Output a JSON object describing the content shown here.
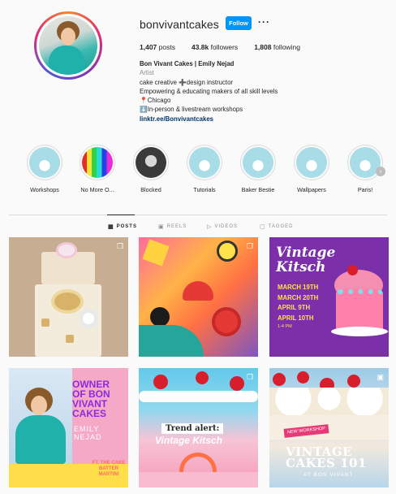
{
  "profile": {
    "username": "bonvivantcakes",
    "follow_label": "Follow",
    "more_label": "···",
    "stats": {
      "posts_count": "1,407",
      "posts_label": "posts",
      "followers_count": "43.8k",
      "followers_label": "followers",
      "following_count": "1,808",
      "following_label": "following"
    },
    "bio": {
      "name": "Bon Vivant Cakes | Emily Nejad",
      "category": "Artist",
      "line1": "cake creative ➕design instructor",
      "line2": "Empowering & educating makers of all skill levels",
      "line3": "📍Chicago",
      "line4": "⬇️In-person & livestream workshops",
      "link": "linktr.ee/Bonvivantcakes"
    }
  },
  "highlights": [
    {
      "label": "Workshops",
      "color": "#7fcfe0"
    },
    {
      "label": "No More O...",
      "color": "#111111"
    },
    {
      "label": "Blocked",
      "color": "#333333"
    },
    {
      "label": "Tutorials",
      "color": "#7fcfe0"
    },
    {
      "label": "Baker Bestie",
      "color": "#7fcfe0"
    },
    {
      "label": "Wallpapers",
      "color": "#7fcfe0"
    },
    {
      "label": "Paris!",
      "color": "#7fcfe0"
    }
  ],
  "highlight_next_icon": "chevron-right-icon",
  "tabs": [
    {
      "label": "POSTS",
      "icon": "grid-icon",
      "active": true
    },
    {
      "label": "REELS",
      "icon": "reels-icon",
      "active": false
    },
    {
      "label": "VIDEOS",
      "icon": "video-icon",
      "active": false
    },
    {
      "label": "TAGGED",
      "icon": "tag-icon",
      "active": false
    }
  ],
  "posts": {
    "p3": {
      "title_line1": "Vintage",
      "title_line2": "Kitsch",
      "date1": "MARCH 19TH",
      "date2": "MARCH 20TH",
      "date3": "APRIL 9TH",
      "date4": "APRIL 10TH",
      "time": "1-4 PM"
    },
    "p4": {
      "owner_line1": "OWNER",
      "owner_line2": "OF BON",
      "owner_line3": "VIVANT",
      "owner_line4": "CAKES",
      "name": "EMILY NEJAD",
      "ft": "FT. THE CAKE BATTER MARTINI"
    },
    "p5": {
      "trend": "Trend alert:",
      "kitsch": "Vintage Kitsch"
    },
    "p6": {
      "new_workshop": "NEW WORKSHOP",
      "title_line1": "VINTAGE",
      "title_line2": "CAKES 101",
      "subtitle": "AT BON VIVANT"
    }
  },
  "colors": {
    "follow_button": "#0095f6",
    "link": "#00376b",
    "muted_text": "#8e8e8e"
  }
}
